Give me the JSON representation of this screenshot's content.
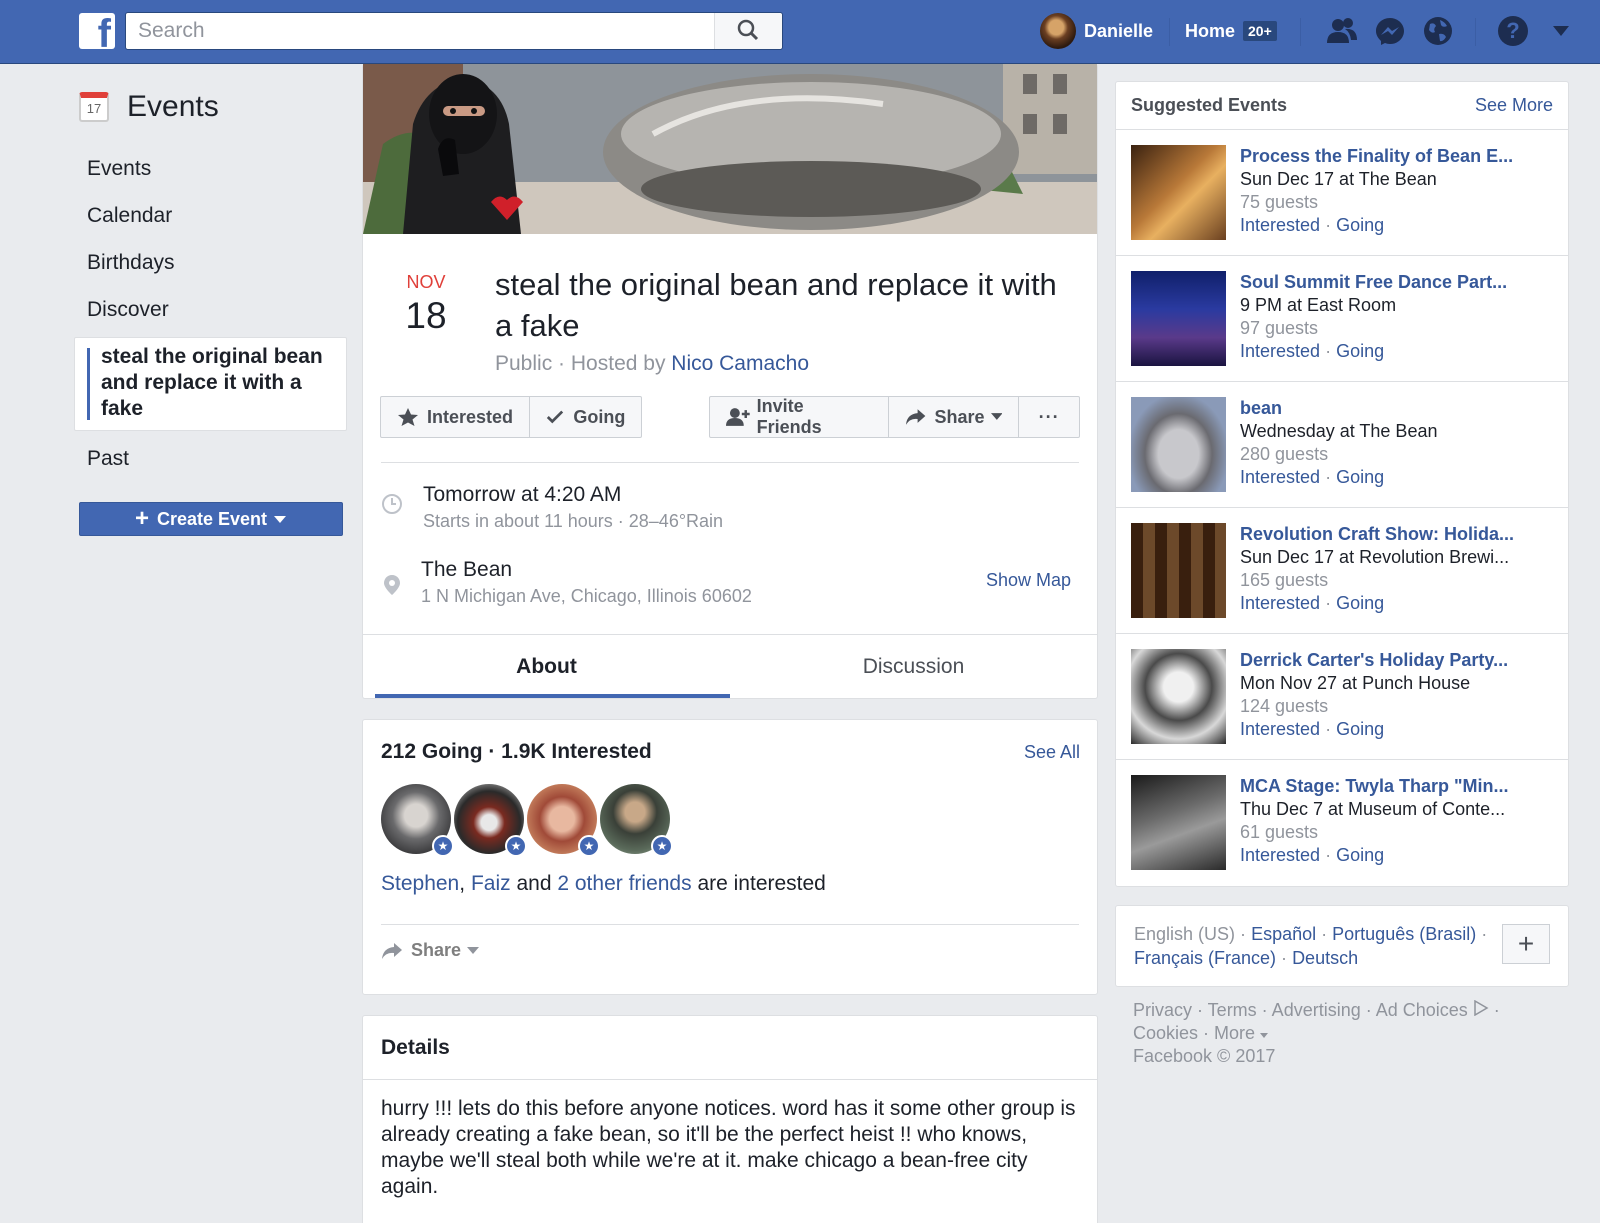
{
  "topbar": {
    "search_placeholder": "Search",
    "user_name": "Danielle",
    "home_label": "Home",
    "home_badge": "20+"
  },
  "icons": {
    "logo": "facebook-f-logo",
    "search": "magnifier-icon",
    "friends": "friends-icon",
    "messenger": "messenger-icon",
    "globe": "globe-icon",
    "help": "question-icon",
    "menu": "caret-down-icon"
  },
  "left_nav": {
    "title": "Events",
    "calendar_day": "17",
    "items": [
      "Events",
      "Calendar",
      "Birthdays",
      "Discover"
    ],
    "active_item": "steal the original bean and replace it with a fake",
    "past": "Past",
    "create_event": "Create Event"
  },
  "event": {
    "month": "NOV",
    "day": "18",
    "title": "steal the original bean and replace it with a fake",
    "privacy": "Public",
    "hosted_by": "Hosted by",
    "host": "Nico Camacho",
    "separator": "·",
    "actions": {
      "interested": "Interested",
      "going": "Going",
      "invite": "Invite Friends",
      "share": "Share",
      "more": "···"
    },
    "time_main": "Tomorrow at 4:20 AM",
    "time_sub": "Starts in about 11 hours · 28–46°Rain",
    "place_name": "The Bean",
    "place_address": "1 N Michigan Ave, Chicago, Illinois 60602",
    "show_map": "Show Map",
    "tabs": [
      "About",
      "Discussion"
    ]
  },
  "attendance": {
    "summary": "212 Going · 1.9K Interested",
    "see_all": "See All",
    "friend1": "Stephen",
    "comma": ",",
    "friend2": "Faiz",
    "and": "and",
    "others": "2 other friends",
    "tail": "are interested",
    "share": "Share"
  },
  "details": {
    "title": "Details",
    "body": "hurry !!! lets do this before anyone notices. word has it some other group is already creating a fake bean, so it'll be the perfect heist !! who knows, maybe we'll steal both while we're at it. make chicago a bean-free city again."
  },
  "suggested": {
    "title": "Suggested Events",
    "see_more": "See More",
    "interested": "Interested",
    "going": "Going",
    "dot": "·",
    "items": [
      {
        "title": "Process the Finality of Bean E...",
        "when": "Sun Dec 17 at The Bean",
        "guests": "75 guests"
      },
      {
        "title": "Soul Summit Free Dance Part...",
        "when": "9 PM at East Room",
        "guests": "97 guests"
      },
      {
        "title": "bean",
        "when": "Wednesday at The Bean",
        "guests": "280 guests"
      },
      {
        "title": "Revolution Craft Show: Holida...",
        "when": "Sun Dec 17 at Revolution Brewi...",
        "guests": "165 guests"
      },
      {
        "title": "Derrick Carter's Holiday Party...",
        "when": "Mon Nov 27 at Punch House",
        "guests": "124 guests"
      },
      {
        "title": "MCA Stage: Twyla Tharp \"Min...",
        "when": "Thu Dec 7 at Museum of Conte...",
        "guests": "61 guests"
      }
    ]
  },
  "footer": {
    "lang_current": "English (US)",
    "langs": [
      "Español",
      "Português (Brasil)",
      "Français (France)",
      "Deutsch"
    ],
    "plus": "+",
    "links_line1": "Privacy · Terms · Advertising · Ad Choices",
    "links_line2": "Cookies · More",
    "copyright": "Facebook © 2017"
  }
}
